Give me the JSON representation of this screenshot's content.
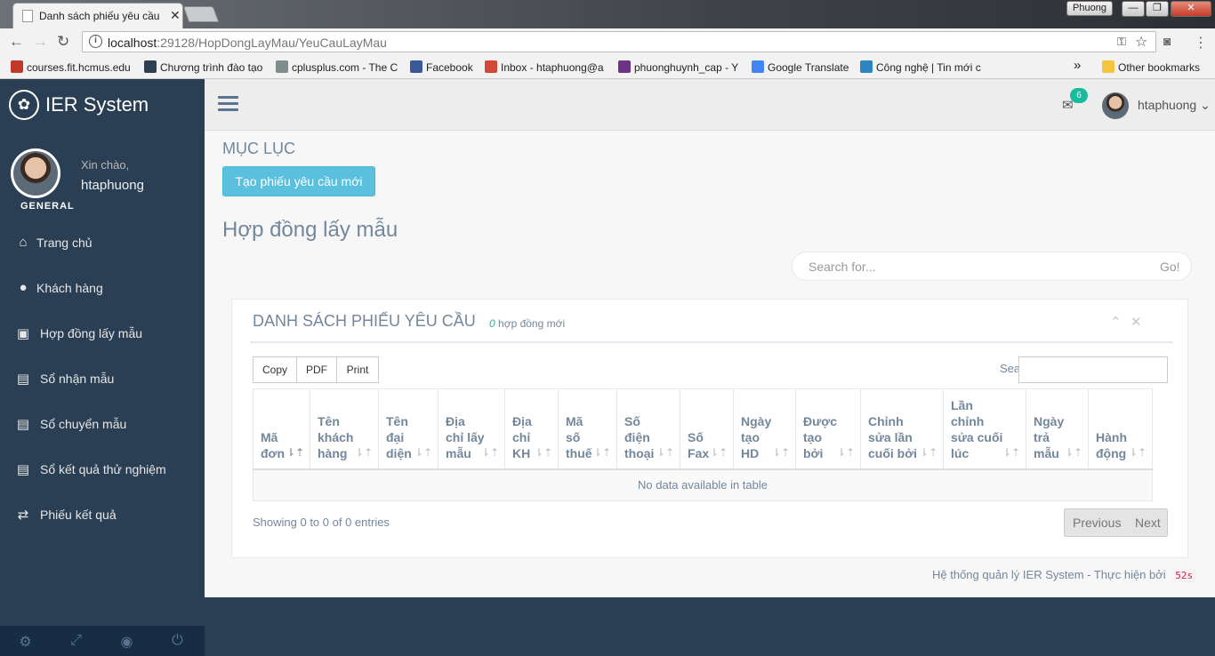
{
  "browser": {
    "tab_title": "Danh sách phiếu yêu cầu",
    "tab_close": "✕",
    "user": "Phuong",
    "window_buttons": {
      "min": "—",
      "max": "❐",
      "close": "✕"
    },
    "url_host": "localhost",
    "url_rest": ":29128/HopDongLayMau/YeuCauLayMau",
    "bookmarks": [
      {
        "label": "courses.fit.hcmus.edu",
        "color": "#c0392b"
      },
      {
        "label": "Chương trình đào tạo",
        "color": "#2c3e50"
      },
      {
        "label": "cplusplus.com - The C",
        "color": "#7f8c8d"
      },
      {
        "label": "Facebook",
        "color": "#3b5998"
      },
      {
        "label": "Inbox - htaphuong@a",
        "color": "#d14836"
      },
      {
        "label": "phuonghuynh_cap - Y",
        "color": "#6c3483"
      },
      {
        "label": "Google Translate",
        "color": "#4285f4"
      },
      {
        "label": "Công nghệ | Tin mới c",
        "color": "#2e86c1"
      }
    ],
    "bookmarks_overflow": "»",
    "other_bookmarks": "Other bookmarks"
  },
  "sidebar": {
    "brand": "IER System",
    "greeting": "Xin chào,",
    "username": "htaphuong",
    "section": "GENERAL",
    "menu": [
      {
        "label": "Trang chủ",
        "icon": "home-icon"
      },
      {
        "label": "Khách hàng",
        "icon": "user-icon"
      },
      {
        "label": "Hợp đồng lấy mẫu",
        "icon": "briefcase-icon"
      },
      {
        "label": "Sổ nhận mẫu",
        "icon": "book-icon"
      },
      {
        "label": "Sổ chuyển mẫu",
        "icon": "book-icon"
      },
      {
        "label": "Sổ kết quả thử nghiệm",
        "icon": "book-icon"
      },
      {
        "label": "Phiếu kết quả",
        "icon": "retweet-icon"
      }
    ]
  },
  "topnav": {
    "mail_count": "6",
    "username": "htaphuong",
    "caret": "⌄"
  },
  "main": {
    "heading": "MỤC LỤC",
    "new_button": "Tạo phiếu yêu cầu mới",
    "title": "Hợp đồng lấy mẫu",
    "search_placeholder": "Search for...",
    "search_go": "Go!"
  },
  "panel": {
    "title": "DANH SÁCH PHIẾU YÊU CẦU",
    "count": "0",
    "count_suffix": " hợp đồng mới",
    "buttons": [
      "Copy",
      "PDF",
      "Print"
    ],
    "search_label": "Search:",
    "columns": [
      "Mã đơn",
      "Tên khách hàng",
      "Tên đại diện",
      "Địa chỉ lấy mẫu",
      "Địa chỉ KH",
      "Mã số thuế",
      "Số điện thoại",
      "Số Fax",
      "Ngày tạo HD",
      "Được tạo bởi",
      "Chỉnh sửa lần cuối bởi",
      "Lần chỉnh sửa cuối lúc",
      "Ngày trả mẫu",
      "Hành động"
    ],
    "empty": "No data available in table",
    "info": "Showing 0 to 0 of 0 entries",
    "prev": "Previous",
    "next": "Next"
  },
  "footer": {
    "text": "Hệ thống quản lý IER System - Thực hiện bởi",
    "timing": "52s"
  },
  "colors": {
    "sidebar": "#2a3f54",
    "accent": "#1abb9c",
    "button_info": "#5bc0de",
    "text": "#73879c"
  }
}
